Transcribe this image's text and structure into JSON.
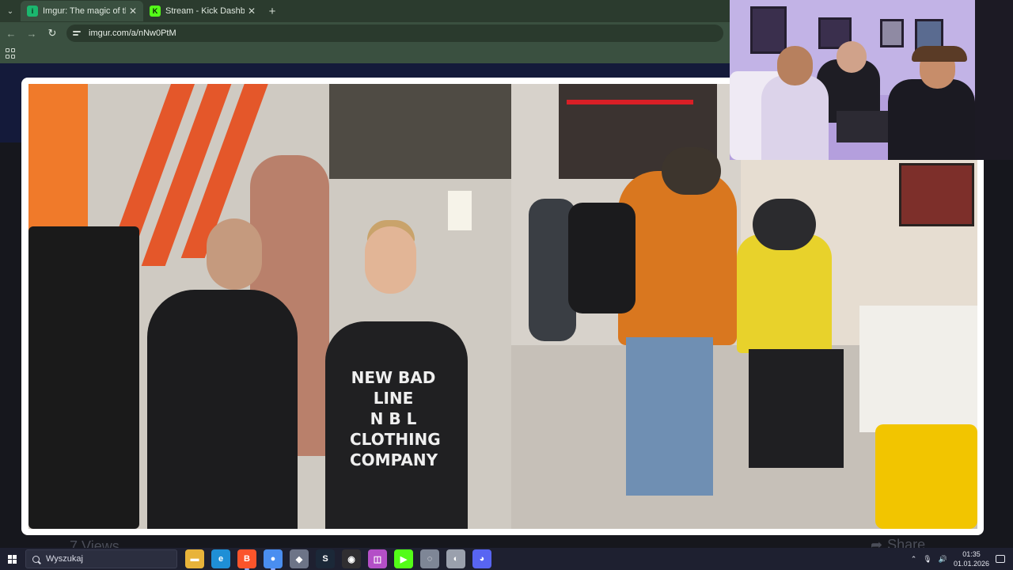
{
  "browser": {
    "tabs": [
      {
        "title": "Imgur: The magic of the Interne",
        "favicon": "imgur-icon",
        "active": true
      },
      {
        "title": "Stream - Kick Dashboard",
        "favicon": "kick-icon",
        "active": false
      }
    ],
    "url": "imgur.com/a/nNw0PtM"
  },
  "page": {
    "views": "7 Views",
    "share_label": "Share",
    "photo_left": {
      "shirt_text": "NEW BAD LINE\nN B L\nCLOTHING COMPANY"
    }
  },
  "taskbar": {
    "search_placeholder": "Wyszukaj",
    "time": "01:35",
    "date": "01.01.2026",
    "apps": [
      {
        "name": "file-explorer-icon",
        "color": "#e8b33a",
        "glyph": "▬"
      },
      {
        "name": "edge-icon",
        "color": "#1f8fd6",
        "glyph": "e"
      },
      {
        "name": "brave-icon",
        "color": "#fb542b",
        "glyph": "B"
      },
      {
        "name": "chrome-icon",
        "color": "#4a8ef0",
        "glyph": "●"
      },
      {
        "name": "app-icon-1",
        "color": "#6d7487",
        "glyph": "◆"
      },
      {
        "name": "steam-icon",
        "color": "#1b2838",
        "glyph": "S"
      },
      {
        "name": "obs-icon",
        "color": "#302e31",
        "glyph": "◉"
      },
      {
        "name": "app-icon-2",
        "color": "#b44fc7",
        "glyph": "◫"
      },
      {
        "name": "kick-icon",
        "color": "#53fc18",
        "glyph": "▶"
      },
      {
        "name": "app-icon-3",
        "color": "#7e8696",
        "glyph": "◌"
      },
      {
        "name": "app-icon-4",
        "color": "#9aa0ad",
        "glyph": "◐"
      },
      {
        "name": "discord-icon",
        "color": "#5865f2",
        "glyph": "◕"
      }
    ]
  }
}
